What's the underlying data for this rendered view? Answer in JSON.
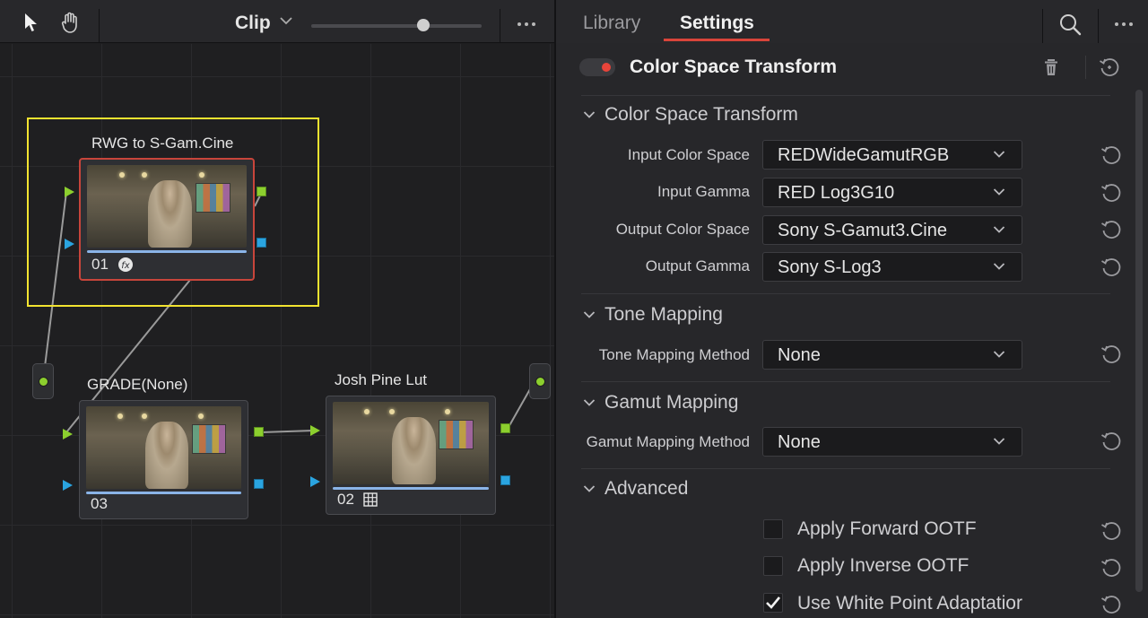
{
  "node_toolbar": {
    "clip_label": "Clip",
    "zoom_level": 0.66
  },
  "nodes": {
    "node1": {
      "title": "RWG to S-Gam.Cine",
      "number": "01"
    },
    "node3": {
      "title": "GRADE(None)",
      "number": "03"
    },
    "node2": {
      "title": "Josh Pine Lut",
      "number": "02"
    }
  },
  "tabs": {
    "library": "Library",
    "settings": "Settings"
  },
  "effect": {
    "title": "Color Space Transform",
    "enabled": true
  },
  "sections": {
    "cst": {
      "title": "Color Space Transform",
      "rows": [
        {
          "label": "Input Color Space",
          "value": "REDWideGamutRGB"
        },
        {
          "label": "Input Gamma",
          "value": "RED Log3G10"
        },
        {
          "label": "Output Color Space",
          "value": "Sony S-Gamut3.Cine"
        },
        {
          "label": "Output Gamma",
          "value": "Sony S-Log3"
        }
      ]
    },
    "tone": {
      "title": "Tone Mapping",
      "label": "Tone Mapping Method",
      "value": "None"
    },
    "gamut": {
      "title": "Gamut Mapping",
      "label": "Gamut Mapping Method",
      "value": "None"
    },
    "advanced": {
      "title": "Advanced",
      "options": [
        {
          "label": "Apply Forward OOTF",
          "checked": false
        },
        {
          "label": "Apply Inverse OOTF",
          "checked": false
        },
        {
          "label": "Use White Point Adaptatior",
          "checked": true
        }
      ]
    }
  },
  "colors": {
    "accent_red": "#d9443a",
    "port_green": "#8ccf2e",
    "port_blue": "#2aa4e0",
    "highlight_yellow": "#f2e330"
  }
}
